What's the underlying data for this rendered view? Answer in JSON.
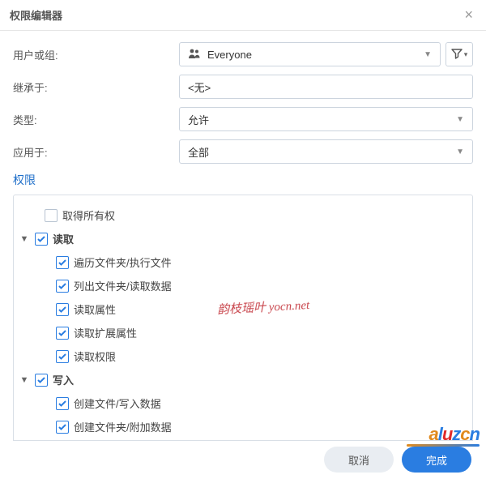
{
  "header": {
    "title": "权限编辑器"
  },
  "form": {
    "userLabel": "用户或组:",
    "userValue": "Everyone",
    "inheritLabel": "继承于:",
    "inheritValue": "<无>",
    "typeLabel": "类型:",
    "typeValue": "允许",
    "applyLabel": "应用于:",
    "applyValue": "全部"
  },
  "section": {
    "title": "权限"
  },
  "tree": [
    {
      "label": "取得所有权",
      "checked": false,
      "bold": false,
      "expandable": false,
      "level": 1
    },
    {
      "label": "读取",
      "checked": true,
      "bold": true,
      "expandable": true,
      "level": 0
    },
    {
      "label": "遍历文件夹/执行文件",
      "checked": true,
      "bold": false,
      "expandable": false,
      "level": 2
    },
    {
      "label": "列出文件夹/读取数据",
      "checked": true,
      "bold": false,
      "expandable": false,
      "level": 2
    },
    {
      "label": "读取属性",
      "checked": true,
      "bold": false,
      "expandable": false,
      "level": 2
    },
    {
      "label": "读取扩展属性",
      "checked": true,
      "bold": false,
      "expandable": false,
      "level": 2
    },
    {
      "label": "读取权限",
      "checked": true,
      "bold": false,
      "expandable": false,
      "level": 2
    },
    {
      "label": "写入",
      "checked": true,
      "bold": true,
      "expandable": true,
      "level": 0
    },
    {
      "label": "创建文件/写入数据",
      "checked": true,
      "bold": false,
      "expandable": false,
      "level": 2
    },
    {
      "label": "创建文件夹/附加数据",
      "checked": true,
      "bold": false,
      "expandable": false,
      "level": 2
    }
  ],
  "watermark": "韵枝瑶叶 yocn.net",
  "footer": {
    "cancel": "取消",
    "done": "完成"
  },
  "logo": {
    "text": "aluzcn"
  }
}
